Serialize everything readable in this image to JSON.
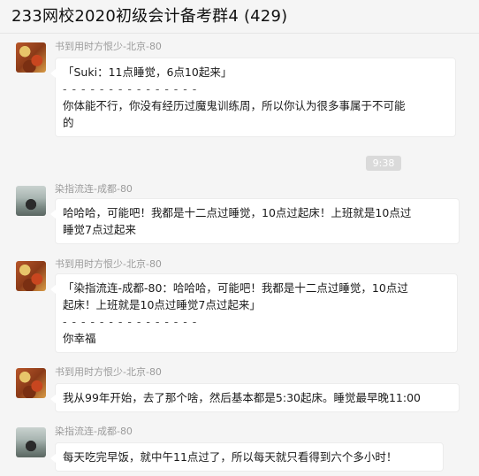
{
  "window": {
    "title": "233网校2020初级会计备考群4 (429)"
  },
  "time_divider": "9:38",
  "messages": [
    {
      "sender": "书到用时方恨少-北京-80",
      "avatar": "autumn-leaves-avatar",
      "lines": [
        "「Suki：11点睡觉，6点10起来」",
        "- - - - - - - - - - - - - - -",
        "你体能不行，你没有经历过魔鬼训练周，所以你认为很多事属于不可能",
        "的"
      ]
    },
    {
      "sender": "染指流连-成都-80",
      "avatar": "person-avatar",
      "lines": [
        "哈哈哈，可能吧！我都是十二点过睡觉，10点过起床！上班就是10点过",
        "睡觉7点过起来"
      ]
    },
    {
      "sender": "书到用时方恨少-北京-80",
      "avatar": "autumn-leaves-avatar",
      "lines": [
        "「染指流连-成都-80：哈哈哈，可能吧！我都是十二点过睡觉，10点过",
        "起床！上班就是10点过睡觉7点过起来」",
        "- - - - - - - - - - - - - - -",
        "你幸福"
      ]
    },
    {
      "sender": "书到用时方恨少-北京-80",
      "avatar": "autumn-leaves-avatar",
      "lines": [
        "我从99年开始，去了那个啥，然后基本都是5:30起床。睡觉最早晚11:00"
      ]
    },
    {
      "sender": "染指流连-成都-80",
      "avatar": "person-avatar",
      "lines": [
        "每天吃完早饭，就中午11点过了，所以每天就只看得到六个多小时！"
      ]
    }
  ]
}
